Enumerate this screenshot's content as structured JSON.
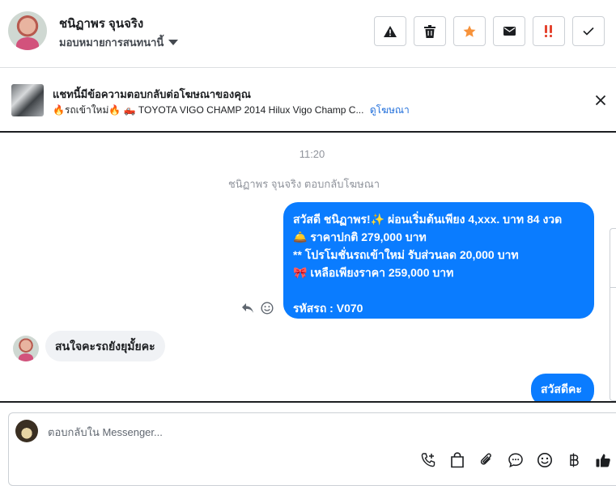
{
  "header": {
    "contact_name": "ชนิฏาพร จุนจริง",
    "assign_label": "มอบหมายการสนทนานี้"
  },
  "actions": [
    {
      "name": "report-spam-button",
      "icon": "warning-icon"
    },
    {
      "name": "delete-button",
      "icon": "trash-icon"
    },
    {
      "name": "star-button",
      "icon": "star-icon",
      "color": "#f7923a"
    },
    {
      "name": "mark-unread-button",
      "icon": "envelope-icon"
    },
    {
      "name": "follow-up-button",
      "icon": "exclamation-icon",
      "color": "#e4432e"
    },
    {
      "name": "mark-done-button",
      "icon": "check-icon"
    }
  ],
  "ad": {
    "title": "แชทนี้มีข้อความตอบกลับต่อโฆษณาของคุณ",
    "subtitle": "🔥รถเข้าใหม่🔥  🛻  TOYOTA VIGO CHAMP 2014 Hilux Vigo Champ C...",
    "link": "ดูโฆษณา"
  },
  "conversation": {
    "time": "11:20",
    "system_message": "ชนิฏาพร จุนจริง ตอบกลับโฆษณา",
    "outgoing_message_lines": [
      "สวัสดี ชนิฏาพร!✨  ผ่อนเริ่มต้นเพียง 4,xxx. บาท 84 งวด",
      "🛎️  ราคาปกติ 279,000 บาท",
      "** โปรโมชั่นรถเข้าใหม่ รับส่วนลด 20,000 บาท",
      "🎀  เหลือเพียงราคา 259,000 บาท",
      "",
      "รหัสรถ : V070"
    ],
    "incoming_message": "สนใจคะรถยังยุมั้ยคะ",
    "outgoing_message_2": "สวัสดีคะ"
  },
  "composer": {
    "placeholder": "ตอบกลับใน Messenger...",
    "tools": [
      "call-add-icon",
      "bag-icon",
      "paperclip-icon",
      "saved-reply-icon",
      "emoji-icon",
      "baht-icon",
      "thumbs-up-icon"
    ]
  },
  "colors": {
    "accent_blue": "#0a7cff",
    "link_blue": "#216fdb",
    "star_orange": "#f7923a",
    "alert_red": "#e4432e"
  }
}
